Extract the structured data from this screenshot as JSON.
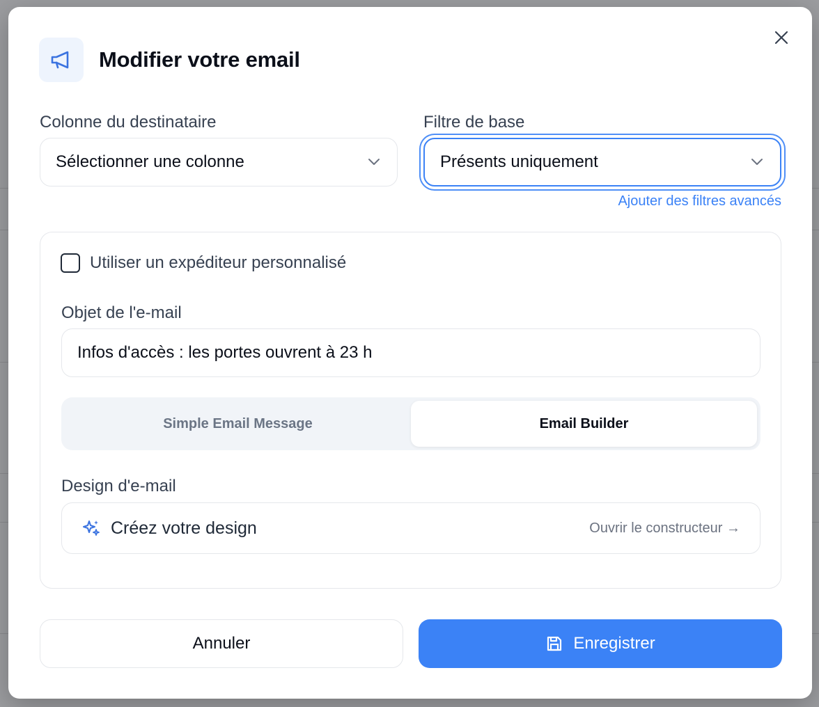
{
  "modal": {
    "title": "Modifier votre email",
    "recipient": {
      "label": "Colonne du destinataire",
      "value": "Sélectionner une colonne"
    },
    "filter": {
      "label": "Filtre de base",
      "value": "Présents uniquement",
      "advanced_link": "Ajouter des filtres avancés"
    },
    "custom_sender": {
      "label": "Utiliser un expéditeur personnalisé",
      "checked": false
    },
    "subject": {
      "label": "Objet de l'e-mail",
      "value": "Infos d'accès : les portes ouvrent à 23 h"
    },
    "mode_tabs": [
      {
        "label": "Simple Email Message",
        "active": false
      },
      {
        "label": "Email Builder",
        "active": true
      }
    ],
    "design": {
      "label": "Design d'e-mail",
      "create_text": "Créez votre design",
      "open_text": "Ouvrir le constructeur →"
    },
    "buttons": {
      "cancel": "Annuler",
      "save": "Enregistrer"
    }
  },
  "colors": {
    "accent": "#3b82f6",
    "border": "#e5e7eb",
    "segment_bg": "#f1f4f8",
    "header_icon_bg": "#eef4fd"
  },
  "icons": {
    "header": "megaphone-icon",
    "close": "close-icon",
    "select_chevron": "chevron-down-icon",
    "design": "sparkles-icon",
    "save": "floppy-disk-icon"
  }
}
